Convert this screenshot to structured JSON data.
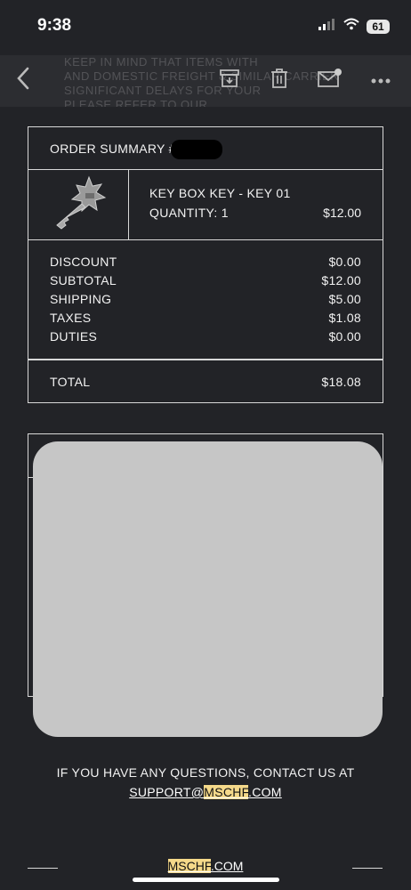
{
  "status_bar": {
    "time": "9:38",
    "battery": "61"
  },
  "toolbar": {
    "faded_lines": [
      "KEEP IN MIND THAT ITEMS WITH",
      "AND DOMESTIC FREIGHT & SIMILAR CARRIER",
      "SIGNIFICANT DELAYS FOR YOUR",
      "PLEASE REFER TO OUR"
    ],
    "icons": [
      "back-icon",
      "archive-icon",
      "trash-icon",
      "mail-icon",
      "more-icon"
    ]
  },
  "order": {
    "summary_label": "ORDER SUMMARY #",
    "item": {
      "name": "KEY BOX KEY - KEY 01",
      "quantity": "QUANTITY: 1",
      "price": "$12.00"
    },
    "totals": [
      {
        "label": "DISCOUNT",
        "value": "$0.00"
      },
      {
        "label": "SUBTOTAL",
        "value": "$12.00"
      },
      {
        "label": "SHIPPING",
        "value": "$5.00"
      },
      {
        "label": "TAXES",
        "value": "$1.08"
      },
      {
        "label": "DUTIES",
        "value": "$0.00"
      }
    ],
    "total_label": "TOTAL",
    "total_value": "$18.08"
  },
  "contact": {
    "line1": "IF YOU HAVE ANY QUESTIONS, CONTACT US AT",
    "email_prefix": "SUPPORT@",
    "email_domain": "MSCHF",
    "email_suffix": ".COM"
  },
  "footer": {
    "brand": "MSCHF",
    "brand_suffix": ".COM"
  },
  "colors": {
    "background": "#222327",
    "toolbar": "#2c2d31",
    "highlight": "#f5d98a",
    "panel_gray": "#c6c6c6"
  }
}
